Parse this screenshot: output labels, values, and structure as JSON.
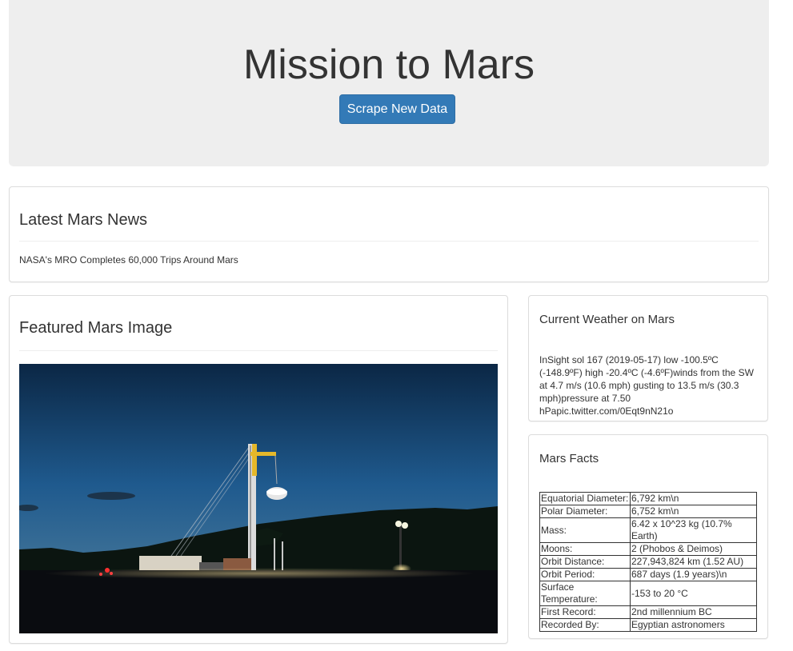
{
  "header": {
    "title": "Mission to Mars",
    "scrape_button": "Scrape New Data"
  },
  "news": {
    "heading": "Latest Mars News",
    "headline": "NASA's MRO Completes 60,000 Trips Around Mars"
  },
  "featured": {
    "heading": "Featured Mars Image",
    "image": "drilling-rig-at-dusk-photo"
  },
  "weather": {
    "heading": "Current Weather on Mars",
    "text": "InSight sol 167 (2019-05-17) low -100.5ºC (-148.9ºF) high -20.4ºC (-4.6ºF)winds from the SW at 4.7 m/s (10.6 mph) gusting to 13.5 m/s (30.3 mph)pressure at 7.50 hPapic.twitter.com/0Eqt9nN21o"
  },
  "facts": {
    "heading": "Mars Facts",
    "rows": [
      {
        "label": "Equatorial Diameter:",
        "value": "6,792 km\\n"
      },
      {
        "label": "Polar Diameter:",
        "value": "6,752 km\\n"
      },
      {
        "label": "Mass:",
        "value": "6.42 x 10^23 kg (10.7% Earth)"
      },
      {
        "label": "Moons:",
        "value": "2 (Phobos & Deimos)"
      },
      {
        "label": "Orbit Distance:",
        "value": "227,943,824 km (1.52 AU)"
      },
      {
        "label": "Orbit Period:",
        "value": "687 days (1.9 years)\\n"
      },
      {
        "label": "Surface Temperature:",
        "value": "-153 to 20 °C"
      },
      {
        "label": "First Record:",
        "value": "2nd millennium BC"
      },
      {
        "label": "Recorded By:",
        "value": "Egyptian astronomers"
      }
    ]
  },
  "colors": {
    "primary": "#337ab7",
    "jumbotron_bg": "#eeeeee"
  }
}
